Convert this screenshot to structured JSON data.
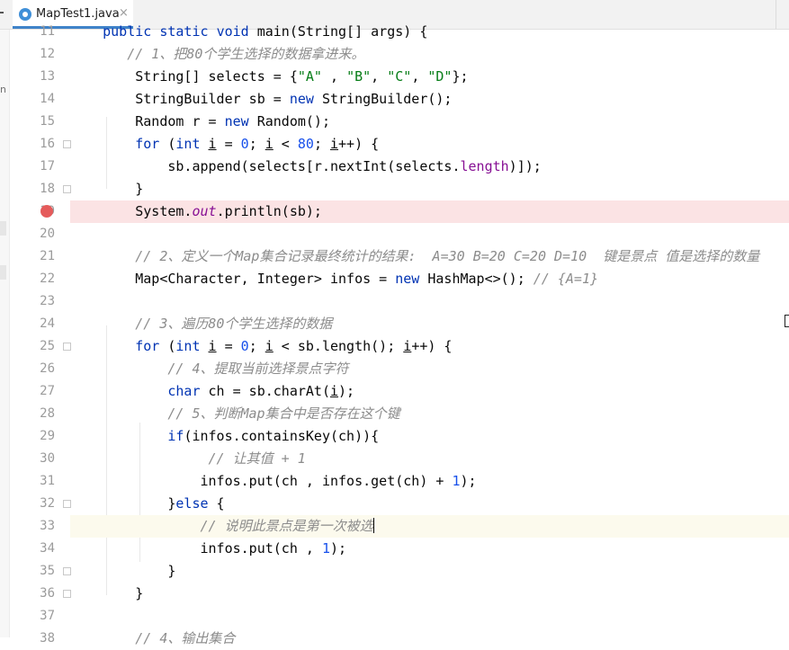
{
  "tab": {
    "title": "MapTest1.java",
    "close": "×",
    "icon": "java-class-icon"
  },
  "left_strip": {
    "label": "n"
  },
  "lines": [
    {
      "num": "11",
      "tokens": [
        {
          "t": "    "
        },
        {
          "t": "public",
          "c": "kw"
        },
        {
          "t": " "
        },
        {
          "t": "static",
          "c": "kw"
        },
        {
          "t": " "
        },
        {
          "t": "void",
          "c": "kw"
        },
        {
          "t": " main(String[] args) {"
        }
      ]
    },
    {
      "num": "12",
      "tokens": [
        {
          "t": "       "
        },
        {
          "t": "// 1、把80个学生选择的数据拿进来。",
          "c": "cmt"
        }
      ]
    },
    {
      "num": "13",
      "tokens": [
        {
          "t": "        String[] selects = {"
        },
        {
          "t": "\"A\"",
          "c": "str"
        },
        {
          "t": " , "
        },
        {
          "t": "\"B\"",
          "c": "str"
        },
        {
          "t": ", "
        },
        {
          "t": "\"C\"",
          "c": "str"
        },
        {
          "t": ", "
        },
        {
          "t": "\"D\"",
          "c": "str"
        },
        {
          "t": "};"
        }
      ]
    },
    {
      "num": "14",
      "tokens": [
        {
          "t": "        StringBuilder sb = "
        },
        {
          "t": "new",
          "c": "kw"
        },
        {
          "t": " StringBuilder();"
        }
      ]
    },
    {
      "num": "15",
      "tokens": [
        {
          "t": "        Random r = "
        },
        {
          "t": "new",
          "c": "kw"
        },
        {
          "t": " Random();"
        }
      ]
    },
    {
      "num": "16",
      "tokens": [
        {
          "t": "        "
        },
        {
          "t": "for",
          "c": "kw"
        },
        {
          "t": " ("
        },
        {
          "t": "int",
          "c": "kw"
        },
        {
          "t": " "
        },
        {
          "t": "i",
          "c": "ul"
        },
        {
          "t": " = "
        },
        {
          "t": "0",
          "c": "num"
        },
        {
          "t": "; "
        },
        {
          "t": "i",
          "c": "ul"
        },
        {
          "t": " < "
        },
        {
          "t": "80",
          "c": "num"
        },
        {
          "t": "; "
        },
        {
          "t": "i",
          "c": "ul"
        },
        {
          "t": "++) {"
        }
      ]
    },
    {
      "num": "17",
      "tokens": [
        {
          "t": "            sb.append(selects[r.nextInt(selects."
        },
        {
          "t": "length",
          "c": "field"
        },
        {
          "t": ")]);"
        }
      ]
    },
    {
      "num": "18",
      "tokens": [
        {
          "t": "        }"
        }
      ]
    },
    {
      "num": "19",
      "tokens": [
        {
          "t": "        System."
        },
        {
          "t": "out",
          "c": "static"
        },
        {
          "t": ".println(sb);"
        }
      ]
    },
    {
      "num": "20",
      "tokens": []
    },
    {
      "num": "21",
      "tokens": [
        {
          "t": "        "
        },
        {
          "t": "// 2、定义一个Map集合记录最终统计的结果:  A=30 B=20 C=20 D=10  键是景点 值是选择的数量",
          "c": "cmt"
        }
      ]
    },
    {
      "num": "22",
      "tokens": [
        {
          "t": "        Map<Character, Integer> infos = "
        },
        {
          "t": "new",
          "c": "kw"
        },
        {
          "t": " HashMap<>(); "
        },
        {
          "t": "// {A=1}",
          "c": "cmt"
        }
      ]
    },
    {
      "num": "23",
      "tokens": []
    },
    {
      "num": "24",
      "tokens": [
        {
          "t": "        "
        },
        {
          "t": "// 3、遍历80个学生选择的数据",
          "c": "cmt"
        }
      ]
    },
    {
      "num": "25",
      "tokens": [
        {
          "t": "        "
        },
        {
          "t": "for",
          "c": "kw"
        },
        {
          "t": " ("
        },
        {
          "t": "int",
          "c": "kw"
        },
        {
          "t": " "
        },
        {
          "t": "i",
          "c": "ul"
        },
        {
          "t": " = "
        },
        {
          "t": "0",
          "c": "num"
        },
        {
          "t": "; "
        },
        {
          "t": "i",
          "c": "ul"
        },
        {
          "t": " < sb.length(); "
        },
        {
          "t": "i",
          "c": "ul"
        },
        {
          "t": "++) {"
        }
      ]
    },
    {
      "num": "26",
      "tokens": [
        {
          "t": "            "
        },
        {
          "t": "// 4、提取当前选择景点字符",
          "c": "cmt"
        }
      ]
    },
    {
      "num": "27",
      "tokens": [
        {
          "t": "            "
        },
        {
          "t": "char",
          "c": "kw"
        },
        {
          "t": " ch = sb.charAt("
        },
        {
          "t": "i",
          "c": "ul"
        },
        {
          "t": ");"
        }
      ]
    },
    {
      "num": "28",
      "tokens": [
        {
          "t": "            "
        },
        {
          "t": "// 5、判断Map集合中是否存在这个键",
          "c": "cmt"
        }
      ]
    },
    {
      "num": "29",
      "tokens": [
        {
          "t": "            "
        },
        {
          "t": "if",
          "c": "kw"
        },
        {
          "t": "(infos.containsKey(ch)){"
        }
      ]
    },
    {
      "num": "30",
      "tokens": [
        {
          "t": "                 "
        },
        {
          "t": "// 让其值 + 1",
          "c": "cmt"
        }
      ]
    },
    {
      "num": "31",
      "tokens": [
        {
          "t": "                infos.put(ch , infos.get(ch) + "
        },
        {
          "t": "1",
          "c": "num"
        },
        {
          "t": ");"
        }
      ]
    },
    {
      "num": "32",
      "tokens": [
        {
          "t": "            }"
        },
        {
          "t": "else",
          "c": "kw"
        },
        {
          "t": " {"
        }
      ]
    },
    {
      "num": "33",
      "tokens": [
        {
          "t": "                "
        },
        {
          "t": "// 说明此景点是第一次被选",
          "c": "cmt"
        }
      ]
    },
    {
      "num": "34",
      "tokens": [
        {
          "t": "                infos.put(ch , "
        },
        {
          "t": "1",
          "c": "num"
        },
        {
          "t": ");"
        }
      ]
    },
    {
      "num": "35",
      "tokens": [
        {
          "t": "            }"
        }
      ]
    },
    {
      "num": "36",
      "tokens": [
        {
          "t": "        }"
        }
      ]
    },
    {
      "num": "37",
      "tokens": []
    },
    {
      "num": "38",
      "tokens": [
        {
          "t": "        "
        },
        {
          "t": "// 4、输出集合",
          "c": "cmt"
        }
      ]
    }
  ],
  "breakpoint_line": "19",
  "caret_line": "33",
  "intention_line": "33",
  "fold_lines": [
    "16",
    "18",
    "25",
    "32",
    "35",
    "36"
  ]
}
